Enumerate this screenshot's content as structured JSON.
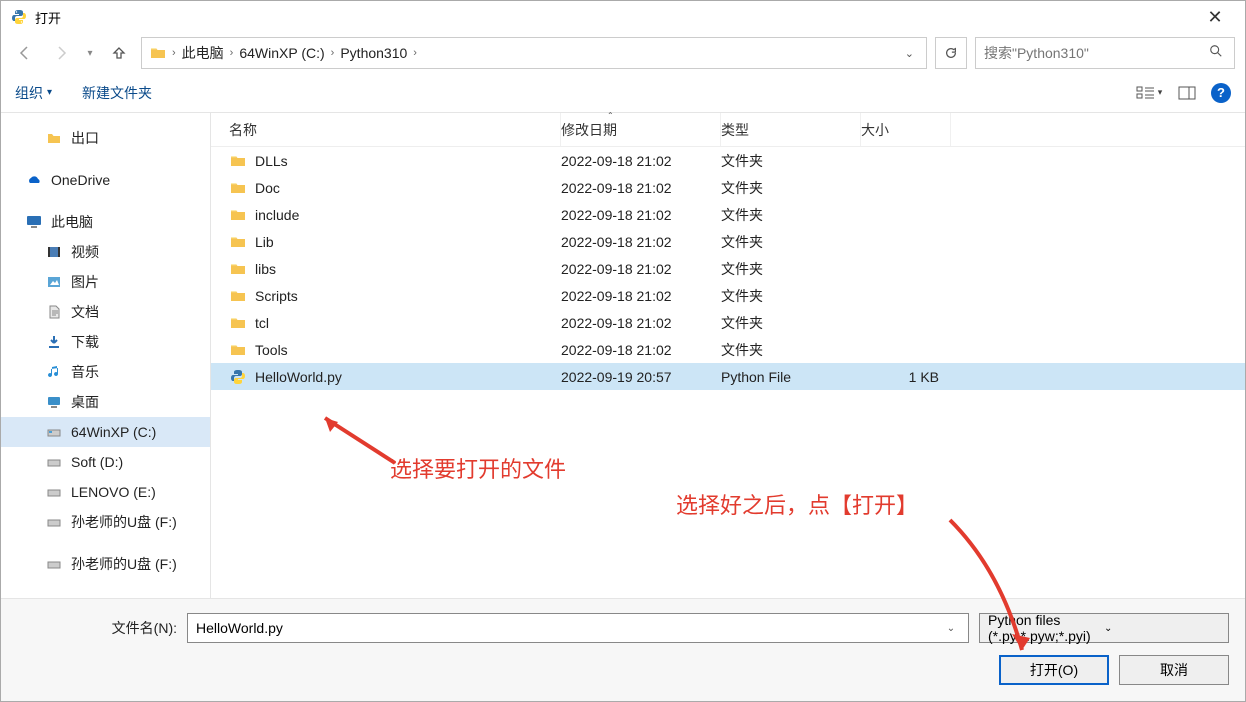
{
  "title": "打开",
  "breadcrumb": {
    "root": "此电脑",
    "drive": "64WinXP  (C:)",
    "folder": "Python310"
  },
  "search": {
    "placeholder": "搜索\"Python310\""
  },
  "toolbar": {
    "organize": "组织",
    "newfolder": "新建文件夹"
  },
  "columns": {
    "name": "名称",
    "modified": "修改日期",
    "type": "类型",
    "size": "大小"
  },
  "tree": {
    "export": "出口",
    "onedrive": "OneDrive",
    "thispc": "此电脑",
    "videos": "视频",
    "pictures": "图片",
    "documents": "文档",
    "downloads": "下载",
    "music": "音乐",
    "desktop": "桌面",
    "drive_c": "64WinXP  (C:)",
    "drive_d": "Soft (D:)",
    "drive_e": "LENOVO (E:)",
    "drive_f": "孙老师的U盘 (F:)",
    "drive_f2": "孙老师的U盘 (F:)"
  },
  "files": [
    {
      "name": "DLLs",
      "date": "2022-09-18 21:02",
      "type": "文件夹",
      "size": "",
      "kind": "folder"
    },
    {
      "name": "Doc",
      "date": "2022-09-18 21:02",
      "type": "文件夹",
      "size": "",
      "kind": "folder"
    },
    {
      "name": "include",
      "date": "2022-09-18 21:02",
      "type": "文件夹",
      "size": "",
      "kind": "folder"
    },
    {
      "name": "Lib",
      "date": "2022-09-18 21:02",
      "type": "文件夹",
      "size": "",
      "kind": "folder"
    },
    {
      "name": "libs",
      "date": "2022-09-18 21:02",
      "type": "文件夹",
      "size": "",
      "kind": "folder"
    },
    {
      "name": "Scripts",
      "date": "2022-09-18 21:02",
      "type": "文件夹",
      "size": "",
      "kind": "folder"
    },
    {
      "name": "tcl",
      "date": "2022-09-18 21:02",
      "type": "文件夹",
      "size": "",
      "kind": "folder"
    },
    {
      "name": "Tools",
      "date": "2022-09-18 21:02",
      "type": "文件夹",
      "size": "",
      "kind": "folder"
    },
    {
      "name": "HelloWorld.py",
      "date": "2022-09-19 20:57",
      "type": "Python File",
      "size": "1 KB",
      "kind": "py",
      "selected": true
    }
  ],
  "bottom": {
    "fname_label": "文件名(N):",
    "fname_value": "HelloWorld.py",
    "filter": "Python files (*.py;*.pyw;*.pyi)",
    "open": "打开(O)",
    "cancel": "取消"
  },
  "annotations": {
    "a1": "选择要打开的文件",
    "a2": "选择好之后，点【打开】"
  }
}
